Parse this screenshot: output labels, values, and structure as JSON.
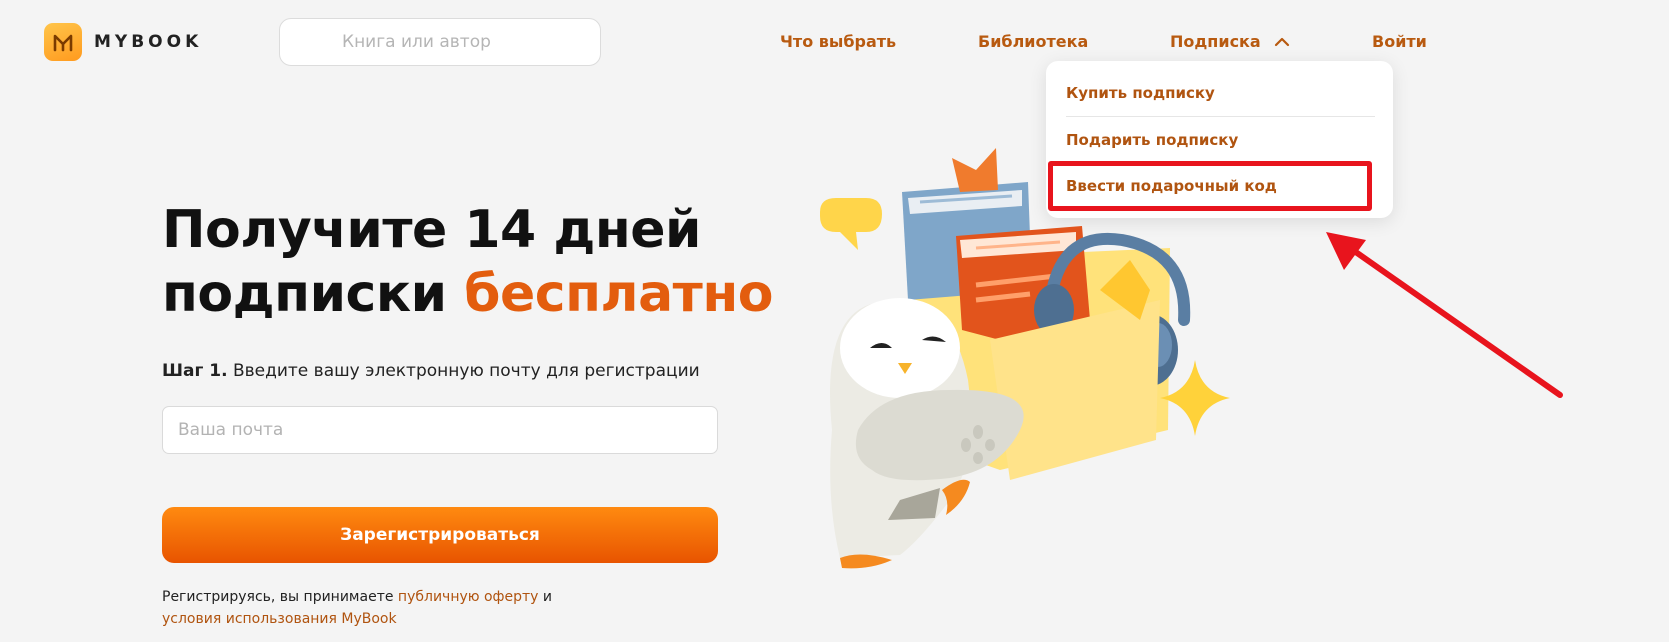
{
  "header": {
    "logo_text": "MYBOOK",
    "search_placeholder": "Книга или автор",
    "nav": {
      "what_to_choose": "Что выбрать",
      "library": "Библиотека",
      "subscription": "Подписка",
      "login": "Войти"
    }
  },
  "dropdown": {
    "items": [
      "Купить подписку",
      "Подарить подписку",
      "Ввести подарочный код"
    ],
    "highlighted_index": 2
  },
  "hero": {
    "title_line1": "Получите 14 дней",
    "title_line2_prefix": "подписки ",
    "title_line2_accent": "бесплатно",
    "step_label": "Шаг 1.",
    "step_text": " Введите вашу электронную почту для регистрации",
    "email_placeholder": "Ваша почта",
    "register_label": "Зарегистрироваться",
    "terms_prefix": "Регистрируясь, вы принимаете ",
    "terms_offer_link": "публичную оферту",
    "terms_and": " и ",
    "terms_conditions_link": "условия использования MyBook"
  },
  "colors": {
    "accent": "#e35d0e",
    "link": "#b05410",
    "highlight": "#e8141d",
    "button_top": "#ff8a10",
    "button_bottom": "#e85400"
  },
  "icons": {
    "logo": "mybook-logo-icon",
    "chevron": "chevron-up-icon",
    "arrow": "red-arrow-annotation-icon"
  }
}
